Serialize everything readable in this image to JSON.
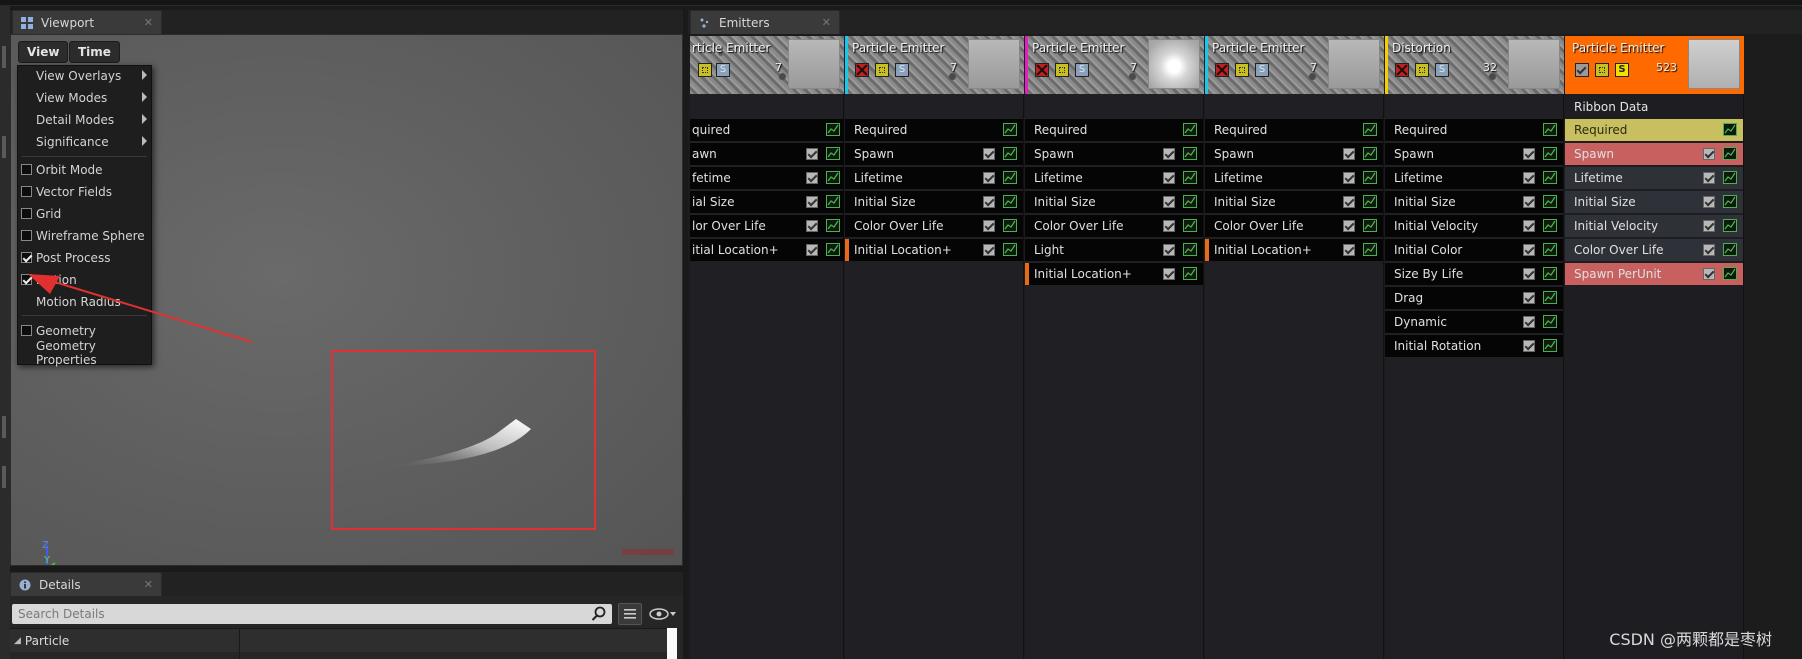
{
  "viewport": {
    "tab_title": "Viewport",
    "view_button": "View",
    "time_button": "Time",
    "menu_submenus": [
      "View Overlays",
      "View Modes",
      "Detail Modes",
      "Significance"
    ],
    "menu_toggles": [
      {
        "label": "Orbit Mode",
        "checked": false
      },
      {
        "label": "Vector Fields",
        "checked": false
      },
      {
        "label": "Grid",
        "checked": false
      },
      {
        "label": "Wireframe Sphere",
        "checked": false
      },
      {
        "label": "Post Process",
        "checked": true
      },
      {
        "label": "Motion",
        "checked": true
      }
    ],
    "motion_radius_label": "Motion Radius",
    "geometry": {
      "label": "Geometry",
      "checked": false
    },
    "geometry_properties_label": "Geometry Properties",
    "axis_labels": {
      "z": "Z",
      "y": "Y"
    }
  },
  "details": {
    "tab_title": "Details",
    "search_placeholder": "Search Details",
    "category_label": "Particle"
  },
  "emitters": {
    "tab_title": "Emitters",
    "columns": [
      {
        "title": "rticle Emitter",
        "count": "7",
        "accent": "#ffffff",
        "icons": [
          "yel",
          "sblue"
        ],
        "modules": [
          "quired",
          "awn",
          "fetime",
          "ial Size",
          "lor Over Life",
          "itial Location+"
        ]
      },
      {
        "title": "Particle Emitter",
        "count": "7",
        "accent": "#18c8e8",
        "icons": [
          "red",
          "yel",
          "sblue"
        ],
        "modules": [
          "Required",
          "Spawn",
          "Lifetime",
          "Initial Size",
          "Color Over Life",
          "Initial Location+"
        ]
      },
      {
        "title": "Particle Emitter",
        "count": "7",
        "accent": "#e020c0",
        "icons": [
          "red",
          "yel",
          "sblue"
        ],
        "modules": [
          "Required",
          "Spawn",
          "Lifetime",
          "Initial Size",
          "Color Over Life",
          "Light",
          "Initial Location+"
        ]
      },
      {
        "title": "Particle Emitter",
        "count": "7",
        "accent": "#18c8e8",
        "icons": [
          "red",
          "yel",
          "sblue"
        ],
        "modules": [
          "Required",
          "Spawn",
          "Lifetime",
          "Initial Size",
          "Color Over Life",
          "Initial Location+"
        ]
      },
      {
        "title": "Distortion",
        "count": "32",
        "accent": "#f2d000",
        "icons": [
          "red",
          "yel",
          "sblue"
        ],
        "modules": [
          "Required",
          "Spawn",
          "Lifetime",
          "Initial Size",
          "Initial Velocity",
          "Initial Color",
          "Size By Life",
          "Drag",
          "Dynamic",
          "Initial Rotation"
        ]
      },
      {
        "title": "Particle Emitter",
        "count": "523",
        "accent": "#ff6a00",
        "icons": [
          "grey",
          "yel",
          "sy"
        ],
        "ribbon_label": "Ribbon Data",
        "modules": [
          "Required",
          "Spawn",
          "Lifetime",
          "Initial Size",
          "Initial Velocity",
          "Color Over Life",
          "Spawn PerUnit"
        ]
      }
    ],
    "icon_letter_s": "S"
  },
  "watermark": "CSDN @两颗都是枣树",
  "colors": {
    "highlight_red": "#e03030",
    "required_highlight": "#c8c060",
    "module_red": "#c86060",
    "module_grey": "#2e3238",
    "ribbon_orange": "#ff6a00"
  }
}
